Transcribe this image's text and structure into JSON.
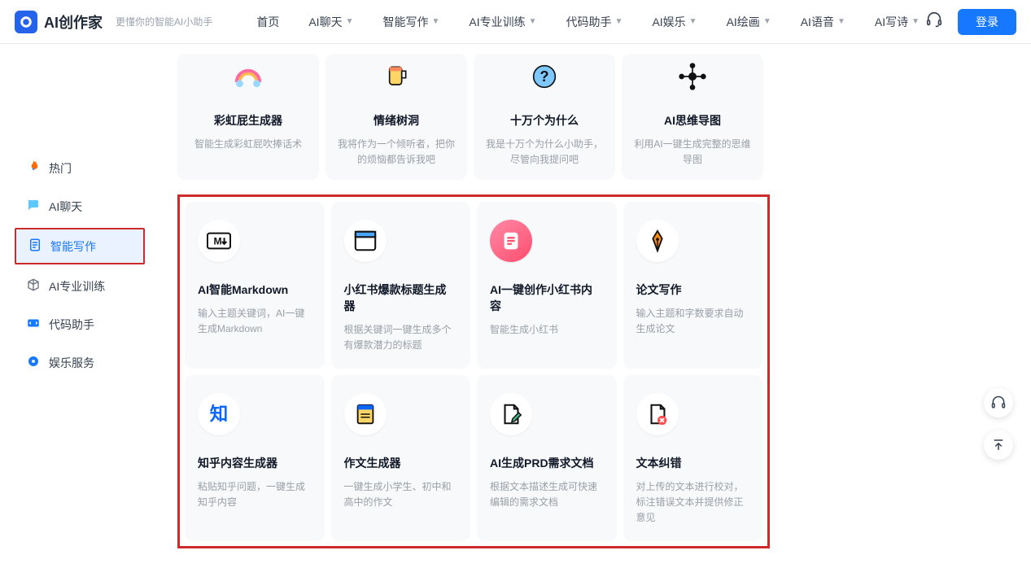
{
  "brand": {
    "title": "AI创作家",
    "subtitle": "更懂你的智能AI小助手"
  },
  "nav": {
    "home": "首页",
    "items": [
      "AI聊天",
      "智能写作",
      "AI专业训练",
      "代码助手",
      "AI娱乐",
      "AI绘画",
      "AI语音",
      "AI写诗"
    ],
    "login": "登录"
  },
  "sidebar": {
    "items": [
      {
        "label": "热门",
        "icon": "fire"
      },
      {
        "label": "AI聊天",
        "icon": "bubble"
      },
      {
        "label": "智能写作",
        "icon": "doc"
      },
      {
        "label": "AI专业训练",
        "icon": "cube"
      },
      {
        "label": "代码助手",
        "icon": "code"
      },
      {
        "label": "娱乐服务",
        "icon": "disc"
      }
    ]
  },
  "top_cards": [
    {
      "title": "彩虹屁生成器",
      "desc": "智能生成彩虹屁吹捧话术"
    },
    {
      "title": "情绪树洞",
      "desc": "我将作为一个倾听者，把你的烦恼都告诉我吧"
    },
    {
      "title": "十万个为什么",
      "desc": "我是十万个为什么小助手，尽管向我提问吧"
    },
    {
      "title": "AI思维导图",
      "desc": "利用AI一键生成完整的思维导图"
    }
  ],
  "cards": [
    {
      "title": "AI智能Markdown",
      "desc": "输入主题关键词，AI一键生成Markdown"
    },
    {
      "title": "小红书爆款标题生成器",
      "desc": "根据关键词一键生成多个有爆款潜力的标题"
    },
    {
      "title": "AI一键创作小红书内容",
      "desc": "智能生成小红书"
    },
    {
      "title": "论文写作",
      "desc": "输入主题和字数要求自动生成论文"
    },
    {
      "title": "知乎内容生成器",
      "desc": "粘贴知乎问题，一键生成知乎内容"
    },
    {
      "title": "作文生成器",
      "desc": "一键生成小学生、初中和高中的作文"
    },
    {
      "title": "AI生成PRD需求文档",
      "desc": "根据文本描述生成可快速编辑的需求文档"
    },
    {
      "title": "文本纠错",
      "desc": "对上传的文本进行校对，标注错误文本并提供修正意见"
    }
  ]
}
